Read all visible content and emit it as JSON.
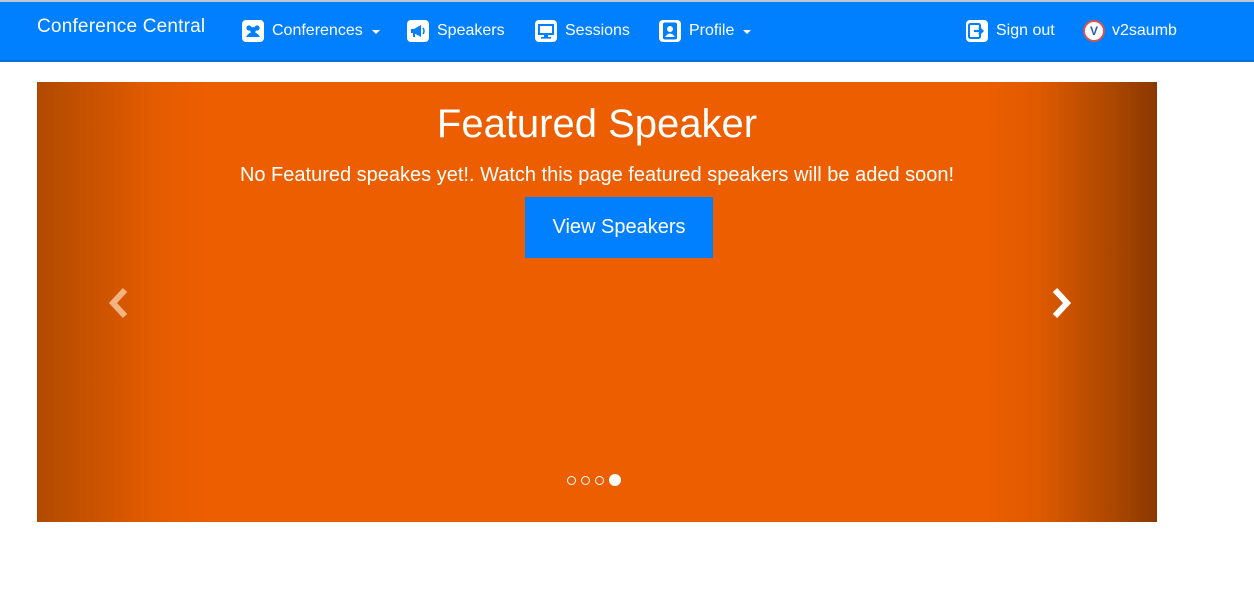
{
  "navbar": {
    "brand": "Conference Central",
    "items": [
      {
        "label": "Conferences",
        "icon": "users-icon",
        "dropdown": true
      },
      {
        "label": "Speakers",
        "icon": "megaphone-icon",
        "dropdown": false
      },
      {
        "label": "Sessions",
        "icon": "monitor-icon",
        "dropdown": false
      },
      {
        "label": "Profile",
        "icon": "user-icon",
        "dropdown": true
      }
    ],
    "sign_out": {
      "label": "Sign out",
      "icon": "sign-out-icon"
    },
    "user": {
      "avatar_letter": "V",
      "name": "v2saumb"
    }
  },
  "carousel": {
    "title": "Featured Speaker",
    "subtitle": "No Featured speakes yet!. Watch this page featured speakers will be aded soon!",
    "button_label": "View Speakers",
    "prev_icon": "chevron-left-icon",
    "next_icon": "chevron-right-icon",
    "slide_count": 4,
    "active_slide": 4
  },
  "colors": {
    "navbar": "#0080ff",
    "slide": "#ec5e00",
    "button": "#0080ff"
  }
}
